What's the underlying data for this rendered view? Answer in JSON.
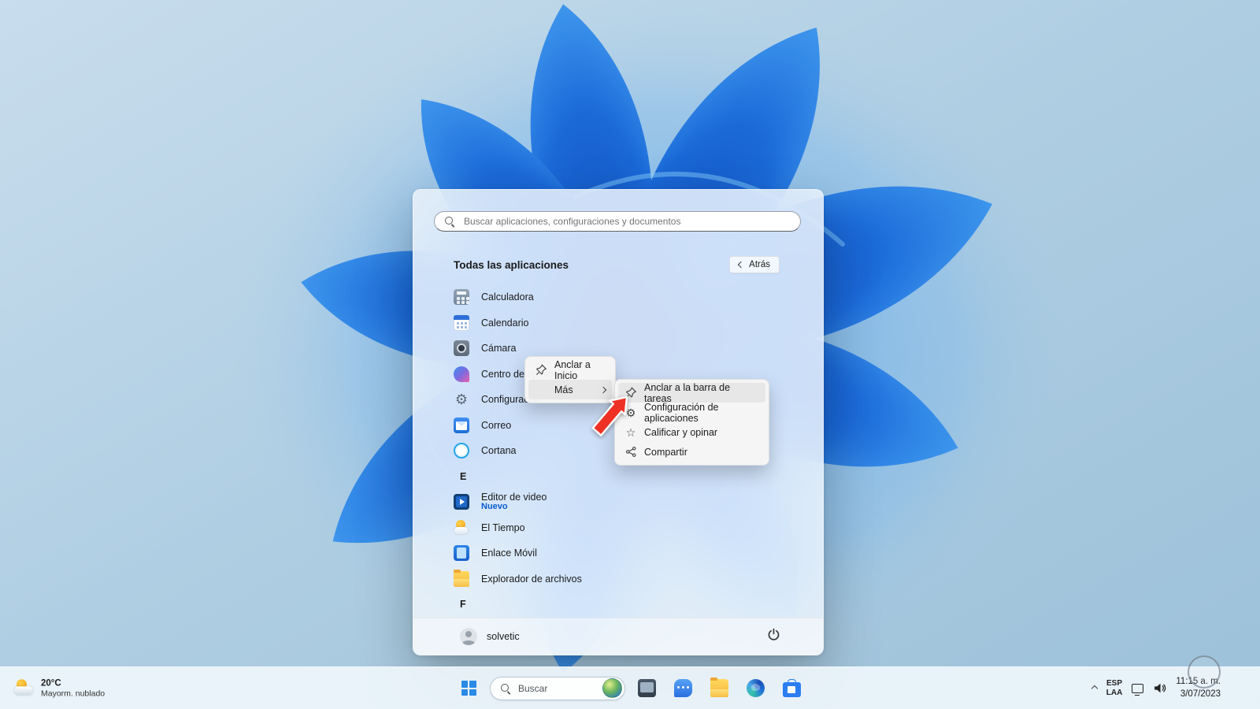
{
  "wallpaper": {
    "sky_color": "#aecde2",
    "bloom_dark": "#0a49b8",
    "bloom_light": "#47a5f5"
  },
  "icons": {
    "gear_glyph": "⚙",
    "star_glyph": "☆"
  },
  "start_menu": {
    "search": {
      "placeholder": "Buscar aplicaciones, configuraciones y documentos"
    },
    "header": {
      "title": "Todas las aplicaciones",
      "back_label": "Atrás"
    },
    "apps": [
      {
        "label": "Calculadora",
        "icon": "calculator-icon"
      },
      {
        "label": "Calendario",
        "icon": "calendar-icon"
      },
      {
        "label": "Cámara",
        "icon": "camera-icon"
      },
      {
        "label": "Centro de opiniones",
        "icon": "feedback-hub-icon"
      },
      {
        "label": "Configuración",
        "icon": "settings-gear-icon"
      },
      {
        "label": "Correo",
        "icon": "mail-icon"
      },
      {
        "label": "Cortana",
        "icon": "cortana-icon"
      },
      {
        "label": "E",
        "type": "section"
      },
      {
        "label": "Editor de video",
        "badge": "Nuevo",
        "icon": "video-editor-icon"
      },
      {
        "label": "El Tiempo",
        "icon": "weather-app-icon"
      },
      {
        "label": "Enlace Móvil",
        "icon": "phone-link-icon"
      },
      {
        "label": "Explorador de archivos",
        "icon": "file-explorer-icon"
      },
      {
        "label": "F",
        "type": "section"
      }
    ],
    "user": {
      "name": "solvetic"
    }
  },
  "context_menu": {
    "items": [
      {
        "label": "Anclar a Inicio",
        "icon": "pin-icon"
      },
      {
        "label": "Más",
        "has_submenu": true
      }
    ]
  },
  "submenu": {
    "items": [
      {
        "label": "Anclar a la barra de tareas",
        "icon": "pin-icon"
      },
      {
        "label": "Configuración de aplicaciones",
        "icon": "gear-icon"
      },
      {
        "label": "Calificar y opinar",
        "icon": "star-icon"
      },
      {
        "label": "Compartir",
        "icon": "share-icon"
      }
    ]
  },
  "taskbar": {
    "weather": {
      "temp": "20°C",
      "condition": "Mayorm. nublado"
    },
    "search_label": "Buscar",
    "tray": {
      "language_line1": "ESP",
      "language_line2": "LAA",
      "time": "11:15 a. m.",
      "date": "3/07/2023"
    }
  }
}
